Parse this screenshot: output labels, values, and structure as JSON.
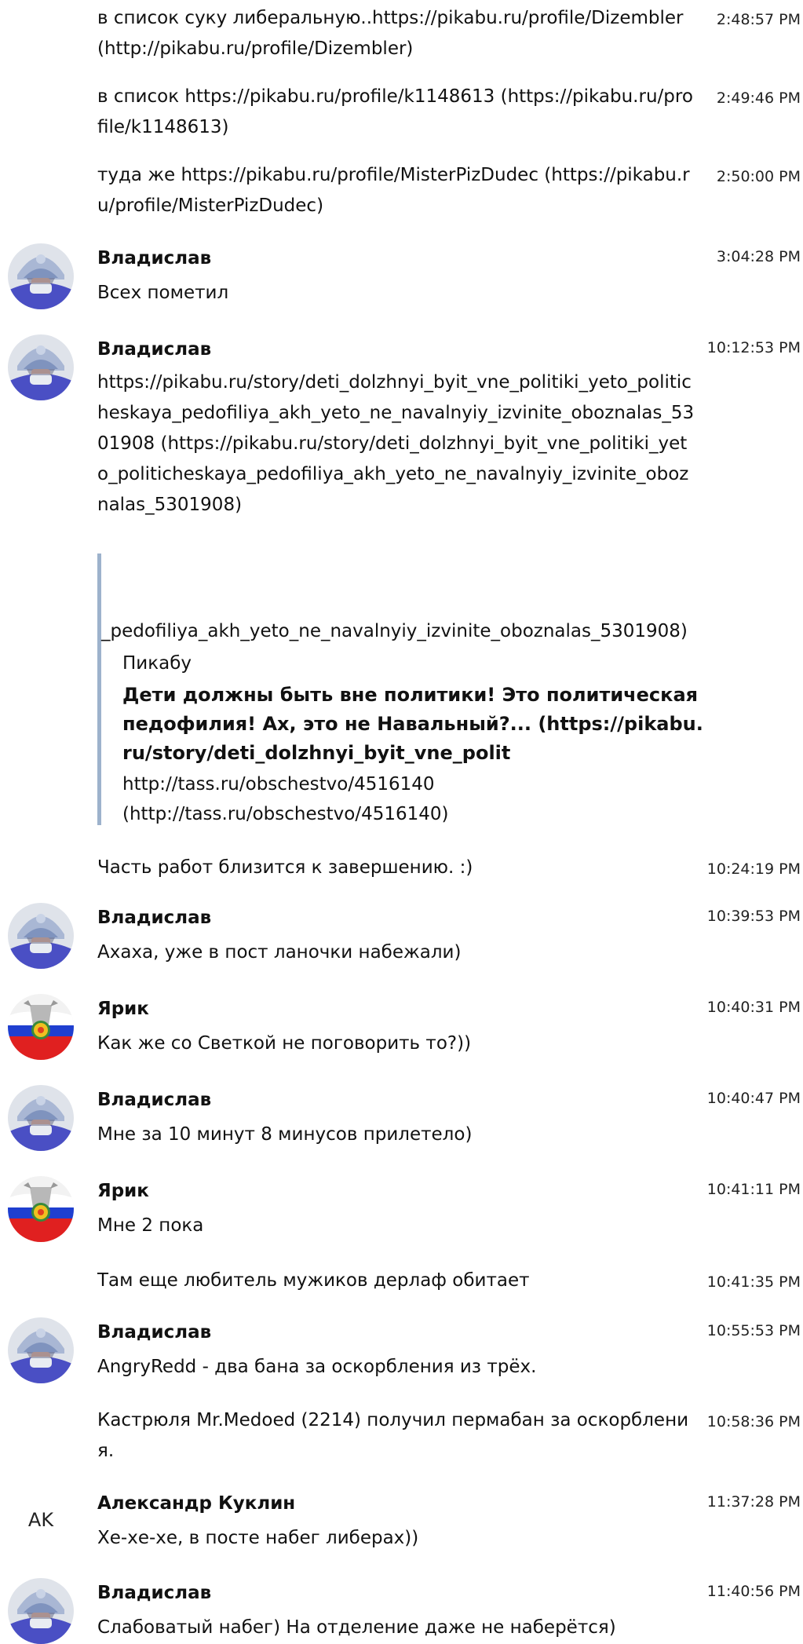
{
  "messages": [
    {
      "text": "в список суку либеральную..https://pikabu.ru/profile/Dizembler (http://pikabu.ru/profile/Dizembler)",
      "time": "2:48:57 PM"
    },
    {
      "text": "в список https://pikabu.ru/profile/k1148613 (https://pikabu.ru/profile/k1148613)",
      "time": "2:49:46 PM"
    },
    {
      "text": "туда же https://pikabu.ru/profile/MisterPizDudec (https://pikabu.ru/profile/MisterPizDudec)",
      "time": "2:50:00 PM"
    },
    {
      "author": "Владислав",
      "text": "Всех пометил",
      "time": "3:04:28 PM"
    },
    {
      "author": "Владислав",
      "text": "https://pikabu.ru/story/deti_dolzhnyi_byit_vne_politiki_yeto_politicheskaya_pedofiliya_akh_yeto_ne_navalnyiy_izvinite_oboznalas_5301908 (https://pikabu.ru/story/deti_dolzhnyi_byit_vne_politiki_yeto_politicheskaya_pedofiliya_akh_yeto_ne_navalnyiy_izvinite_oboznalas_5301908)",
      "time": "10:12:53 PM"
    },
    {
      "text": "Часть работ близится к завершению. :)",
      "time": "10:24:19 PM"
    },
    {
      "author": "Владислав",
      "text": "Ахаха, уже в пост ланочки набежали)",
      "time": "10:39:53 PM"
    },
    {
      "author": "Ярик",
      "text": "Как же со Светкой не поговорить то?))",
      "time": "10:40:31 PM"
    },
    {
      "author": "Владислав",
      "text": "Мне за 10 минут 8 минусов прилетело)",
      "time": "10:40:47 PM"
    },
    {
      "author": "Ярик",
      "text": "Мне 2 пока",
      "time": "10:41:11 PM"
    },
    {
      "text": "Там еще любитель мужиков дерлаф обитает",
      "time": "10:41:35 PM"
    },
    {
      "author": "Владислав",
      "text": "AngryRedd - два бана за оскорбления из трёх.",
      "time": "10:55:53 PM"
    },
    {
      "text": "Кастрюля Mr.Medoed (2214) получил пермабан за оскорбления.",
      "time": "10:58:36 PM"
    },
    {
      "author": "Александр Куклин",
      "initials": "AK",
      "text": "Хе-хе-хе, в посте набег либерах))",
      "time": "11:37:28 PM"
    },
    {
      "author": "Владислав",
      "text": "Слабоватый набег) На отделение даже не наберётся)",
      "time": "11:40:56 PM"
    }
  ],
  "link_preview": {
    "url_tail": "_pedofiliya_akh_yeto_ne_navalnyiy_izvinite_oboznalas_5301908)",
    "site": "Пикабу",
    "title": "Дети должны быть вне политики! Это политическая педофилия! Ах, это не Навальный?... (https://pikabu.ru/story/deti_dolzhnyi_byit_vne_polit",
    "body": "http://tass.ru/obschestvo/4516140 (http://tass.ru/obschestvo/4516140)"
  },
  "colors": {
    "preview_bar": "#9db2cc",
    "avatar_vladislav_bg": "#4a4fc4",
    "avatar_yarik_flag_red": "#e02020",
    "avatar_yarik_flag_blue": "#1f3fd0"
  },
  "icons": {
    "vladislav_avatar": "masked-warrior-avatar-icon",
    "yarik_avatar": "russian-flag-emblem-avatar-icon"
  }
}
